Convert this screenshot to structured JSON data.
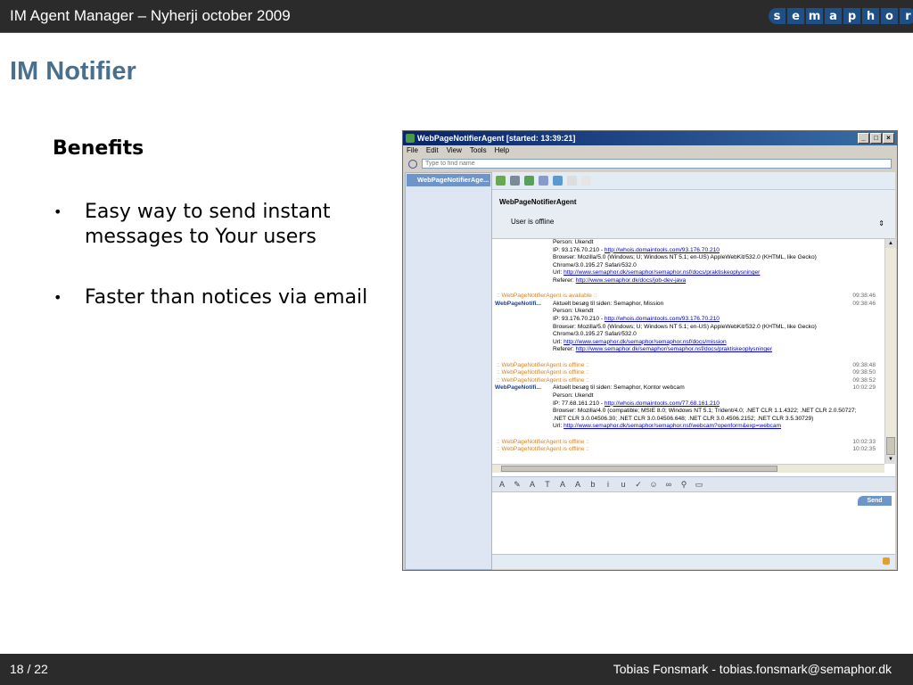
{
  "slide": {
    "header_title": "IM Agent Manager – Nyherji october 2009",
    "logo_letters": [
      "s",
      "e",
      "m",
      "a",
      "p",
      "h",
      "o",
      "r"
    ],
    "title": "IM Notifier",
    "subheading": "Benefits",
    "bullets": [
      "Easy way to send instant messages to Your users",
      "Faster than notices via email"
    ],
    "page_number": "18 / 22",
    "author": "Tobias Fonsmark - tobias.fonsmark@semaphor.dk"
  },
  "app": {
    "window_title": "WebPageNotifierAgent [started: 13:39:21]",
    "window_buttons": [
      "_",
      "□",
      "×"
    ],
    "menu": [
      "File",
      "Edit",
      "View",
      "Tools",
      "Help"
    ],
    "search_placeholder": "Type to find name",
    "contact": "WebPageNotifierAge...",
    "info_name": "WebPageNotifierAgent",
    "info_status": "User is offline",
    "send_label": "Send",
    "messages": [
      {
        "kind": "body",
        "text": "Person: Ukendt"
      },
      {
        "kind": "body",
        "text": "IP: 93.176.70.210 - ",
        "url": "http://whois.domaintools.com/93.176.70.210"
      },
      {
        "kind": "body",
        "text": "Browser: Mozilla/5.0 (Windows; U; Windows NT 5.1; en-US) AppleWebKit/532.0 (KHTML, like Gecko)"
      },
      {
        "kind": "body",
        "text": "Chrome/3.0.195.27 Safari/532.0"
      },
      {
        "kind": "body",
        "text": "Url: ",
        "url": "http://www.semaphor.dk/semaphor/semaphor.nsf/docs/praktiskeoplysninger"
      },
      {
        "kind": "body",
        "text": "Referer: ",
        "url": "http://www.semaphor.dk/docs/job-dev-java"
      },
      {
        "kind": "gap"
      },
      {
        "kind": "sys",
        "text": ":: WebPageNotifierAgent is available ::",
        "time": "09:38:46"
      },
      {
        "kind": "who",
        "who": "WebPageNotifi...",
        "text": "Aktuelt besøg til siden: Semaphor, Mission",
        "time": "09:38:46"
      },
      {
        "kind": "body",
        "text": "Person: Ukendt"
      },
      {
        "kind": "body",
        "text": "IP: 93.176.70.210 - ",
        "url": "http://whois.domaintools.com/93.176.70.210"
      },
      {
        "kind": "body",
        "text": "Browser: Mozilla/5.0 (Windows; U; Windows NT 5.1; en-US) AppleWebKit/532.0 (KHTML, like Gecko)"
      },
      {
        "kind": "body",
        "text": "Chrome/3.0.195.27 Safari/532.0"
      },
      {
        "kind": "body",
        "text": "Url: ",
        "url": "http://www.semaphor.dk/semaphor/semaphor.nsf/docs/mission"
      },
      {
        "kind": "body",
        "text": "Referer: ",
        "url": "http://www.semaphor.dk/semaphor/semaphor.nsf/docs/praktiskeoplysninger"
      },
      {
        "kind": "gap"
      },
      {
        "kind": "sys",
        "text": ":: WebPageNotifierAgent is offline ::",
        "time": "09:38:48"
      },
      {
        "kind": "sys",
        "text": ":: WebPageNotifierAgent is offline ::",
        "time": "09:38:50"
      },
      {
        "kind": "sys",
        "text": ":: WebPageNotifierAgent is offline ::",
        "time": "09:38:52"
      },
      {
        "kind": "who",
        "who": "WebPageNotifi...",
        "text": "Aktuelt besøg til siden: Semaphor, Kontor webcam",
        "time": "10:02:29"
      },
      {
        "kind": "body",
        "text": "Person: Ukendt"
      },
      {
        "kind": "body",
        "text": "IP: 77.68.161.210 - ",
        "url": "http://whois.domaintools.com/77.68.161.210"
      },
      {
        "kind": "body",
        "text": "Browser: Mozilla/4.0 (compatible; MSIE 8.0; Windows NT 5.1; Trident/4.0; .NET CLR 1.1.4322; .NET CLR 2.0.50727;"
      },
      {
        "kind": "body",
        "text": ".NET CLR 3.0.04506.30; .NET CLR 3.0.04506.648; .NET CLR 3.0.4506.2152; .NET CLR 3.5.30729)"
      },
      {
        "kind": "body",
        "text": "Url: ",
        "url": "http://www.semaphor.dk/semaphor/semaphor.nsf/webcam?openform&exp=webcam"
      },
      {
        "kind": "gap"
      },
      {
        "kind": "sys",
        "text": ":: WebPageNotifierAgent is offline ::",
        "time": "10:02:33"
      },
      {
        "kind": "sys",
        "text": ":: WebPageNotifierAgent is offline ::",
        "time": "10:02:35"
      }
    ]
  }
}
